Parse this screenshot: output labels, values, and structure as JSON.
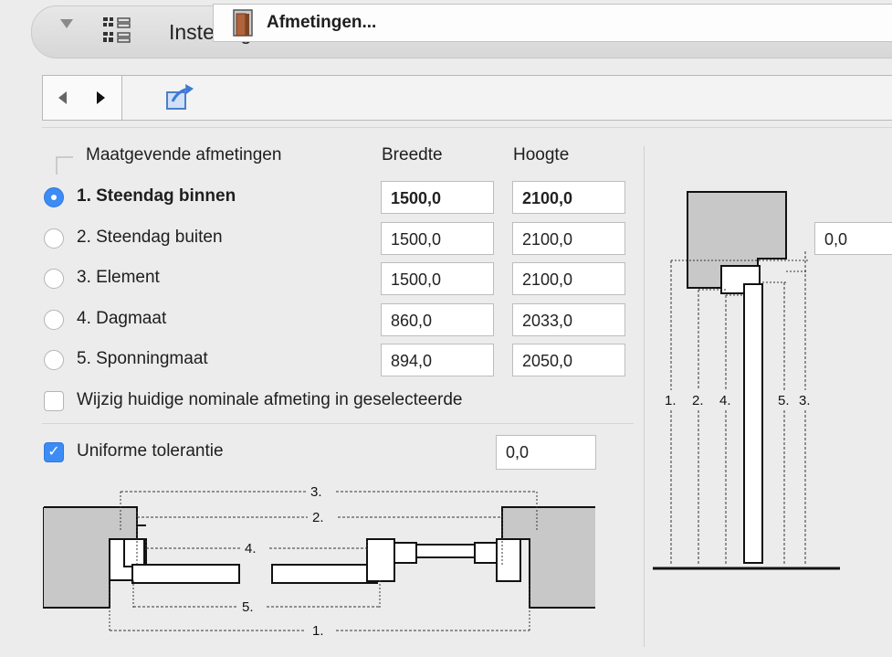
{
  "header": {
    "title": "Instellingen deur"
  },
  "toolbar": {
    "section_label": "Afmetingen..."
  },
  "dimensions": {
    "group_label": "Maatgevende afmetingen",
    "col_width": "Breedte",
    "col_height": "Hoogte",
    "rows": [
      {
        "label": "1. Steendag binnen",
        "width": "1500,0",
        "height": "2100,0",
        "selected": true
      },
      {
        "label": "2. Steendag buiten",
        "width": "1500,0",
        "height": "2100,0",
        "selected": false
      },
      {
        "label": "3. Element",
        "width": "1500,0",
        "height": "2100,0",
        "selected": false
      },
      {
        "label": "4. Dagmaat",
        "width": "860,0",
        "height": "2033,0",
        "selected": false
      },
      {
        "label": "5. Sponningmaat",
        "width": "894,0",
        "height": "2050,0",
        "selected": false
      }
    ],
    "modify_checkbox_label": "Wijzig huidige nominale afmeting in geselecteerde",
    "modify_checked": false
  },
  "tolerance": {
    "label": "Uniforme tolerantie",
    "checked": true,
    "value": "0,0"
  },
  "section_diagram": {
    "offset_value": "0,0",
    "labels": [
      "1.",
      "2.",
      "4.",
      "5.",
      "3."
    ]
  },
  "plan_diagram": {
    "labels": {
      "d1": "1.",
      "d2": "2.",
      "d3": "3.",
      "d4": "4.",
      "d5": "5."
    }
  },
  "colors": {
    "accent": "#3d8bf5"
  }
}
